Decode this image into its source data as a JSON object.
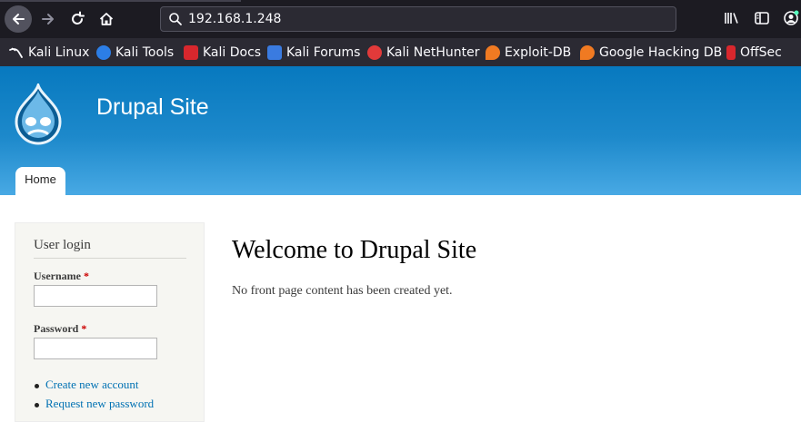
{
  "browser": {
    "url": "192.168.1.248",
    "bookmarks": [
      {
        "label": "Kali Linux",
        "icon": "kali-dragon-icon"
      },
      {
        "label": "Kali Tools",
        "icon": "kali-tools-icon"
      },
      {
        "label": "Kali Docs",
        "icon": "kali-docs-icon"
      },
      {
        "label": "Kali Forums",
        "icon": "kali-forums-icon"
      },
      {
        "label": "Kali NetHunter",
        "icon": "kali-nethunter-icon"
      },
      {
        "label": "Exploit-DB",
        "icon": "exploit-db-icon"
      },
      {
        "label": "Google Hacking DB",
        "icon": "ghdb-icon"
      },
      {
        "label": "OffSec",
        "icon": "offsec-icon"
      }
    ]
  },
  "site": {
    "name": "Drupal Site",
    "nav": {
      "home": "Home"
    },
    "colors": {
      "header_top": "#0779bf",
      "header_bottom": "#48a9e4",
      "link": "#0071b3",
      "required": "#cc0000"
    }
  },
  "login": {
    "title": "User login",
    "username_label": "Username",
    "password_label": "Password",
    "required_mark": "*",
    "links": {
      "create": "Create new account",
      "request": "Request new password"
    }
  },
  "main": {
    "title": "Welcome to Drupal Site",
    "message": "No front page content has been created yet."
  }
}
